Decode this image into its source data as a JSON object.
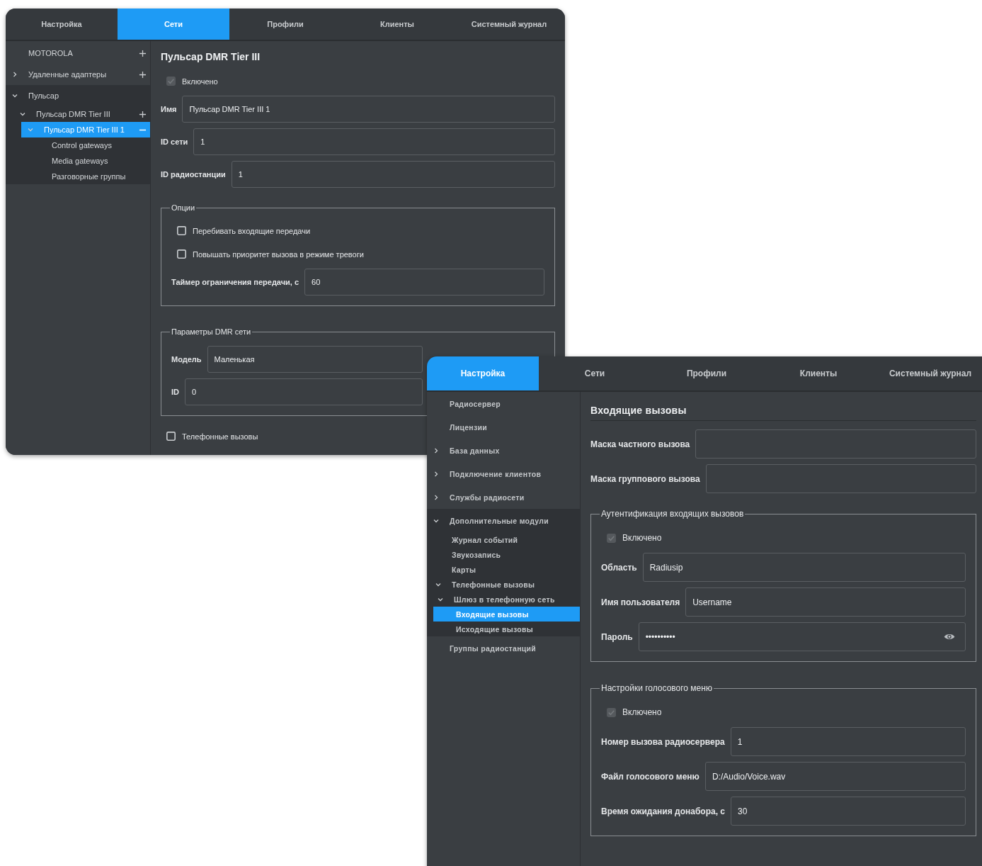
{
  "windows": [
    {
      "tabs": [
        {
          "label": "Настройка",
          "selected": false
        },
        {
          "label": "Сети",
          "selected": true
        },
        {
          "label": "Профили",
          "selected": false
        },
        {
          "label": "Клиенты",
          "selected": false
        },
        {
          "label": "Системный журнал",
          "selected": false
        }
      ],
      "sidebar": {
        "items": [
          {
            "kind": "add",
            "label": "MOTOROLA",
            "selected": false
          },
          {
            "kind": "add",
            "label": "Удаленные адаптеры",
            "selected": false,
            "expanded": false
          },
          {
            "label": "Пульсар",
            "selected": false,
            "expanded": true,
            "children": [
              {
                "kind": "add",
                "label": "Пульсар DMR Tier III",
                "selected": false,
                "expanded": true,
                "children": [
                  {
                    "kind": "remove",
                    "label": "Пульсар DMR Tier III 1",
                    "selected": true,
                    "expanded": true,
                    "children": [
                      {
                        "label": "Control gateways",
                        "selected": false
                      },
                      {
                        "label": "Media gateways",
                        "selected": false
                      },
                      {
                        "label": "Разговорные группы",
                        "selected": false
                      }
                    ]
                  }
                ]
              }
            ]
          }
        ]
      },
      "content": {
        "title": "Пульсар DMR Tier III",
        "items": [
          {
            "kind": "checkbox",
            "label": "Включено",
            "checked": true,
            "disabled": true
          },
          {
            "kind": "field",
            "label": "Имя",
            "value": "Пульсар DMR Tier III 1"
          },
          {
            "kind": "field",
            "label": "ID сети",
            "value": "1"
          },
          {
            "kind": "field",
            "label": "ID радиостанции",
            "value": "1"
          },
          {
            "kind": "group",
            "legend": "Опции",
            "items": [
              {
                "kind": "checkbox",
                "label": "Перебивать входящие передачи",
                "checked": false,
                "disabled": false
              },
              {
                "kind": "checkbox",
                "label": "Повышать приоритет вызова в режиме тревоги",
                "checked": false,
                "disabled": false
              },
              {
                "kind": "field",
                "label": "Таймер ограничения передачи, с",
                "value": "60"
              }
            ]
          },
          {
            "kind": "group",
            "legend": "Параметры DMR сети",
            "items": [
              {
                "kind": "field",
                "label": "Модель",
                "value": "Маленькая"
              },
              {
                "kind": "field",
                "label": "ID",
                "value": "0"
              }
            ]
          },
          {
            "kind": "checkbox",
            "label": "Телефонные вызовы",
            "checked": false,
            "disabled": false
          }
        ]
      }
    },
    {
      "tabs": [
        {
          "label": "Настройка",
          "selected": true
        },
        {
          "label": "Сети",
          "selected": false
        },
        {
          "label": "Профили",
          "selected": false
        },
        {
          "label": "Клиенты",
          "selected": false
        },
        {
          "label": "Системный журнал",
          "selected": false
        }
      ],
      "sidebar": {
        "items": [
          {
            "label": "Радиосервер",
            "selected": false
          },
          {
            "label": "Лицензии",
            "selected": false
          },
          {
            "label": "База данных",
            "selected": false,
            "expanded": false
          },
          {
            "label": "Подключение клиентов",
            "selected": false,
            "expanded": false
          },
          {
            "label": "Службы радиосети",
            "selected": false,
            "expanded": false
          },
          {
            "label": "Дополнительные модули",
            "selected": false,
            "expanded": true,
            "children": [
              {
                "label": "Журнал событий",
                "selected": false
              },
              {
                "label": "Звукозапись",
                "selected": false
              },
              {
                "label": "Карты",
                "selected": false
              },
              {
                "label": "Телефонные вызовы",
                "selected": false,
                "expanded": true,
                "children": [
                  {
                    "label": "Шлюз в телефонную сеть",
                    "selected": false,
                    "expanded": true,
                    "children": [
                      {
                        "label": "Входящие вызовы",
                        "selected": true
                      },
                      {
                        "label": "Исходящие вызовы",
                        "selected": false
                      }
                    ]
                  }
                ]
              }
            ]
          },
          {
            "label": "Группы радиостанций",
            "selected": false
          }
        ]
      },
      "content": {
        "title": "Входящие вызовы",
        "items": [
          {
            "kind": "field",
            "label": "Маска частного вызова"
          },
          {
            "kind": "field",
            "label": "Маска группового вызова"
          },
          {
            "kind": "group",
            "legend": "Аутентификация входящих вызовов",
            "items": [
              {
                "kind": "checkbox",
                "label": "Включено",
                "checked": true,
                "disabled": true
              },
              {
                "kind": "field",
                "label": "Область",
                "value": "Radiusip"
              },
              {
                "kind": "field",
                "label": "Имя пользователя",
                "value": "Username"
              },
              {
                "kind": "password",
                "label": "Пароль",
                "value": "••••••••••"
              }
            ]
          },
          {
            "kind": "group",
            "legend": "Настройки голосового меню",
            "items": [
              {
                "kind": "checkbox",
                "label": "Включено",
                "checked": true,
                "disabled": true
              },
              {
                "kind": "field",
                "label": "Номер вызова радиосервера",
                "value": "1"
              },
              {
                "kind": "field",
                "label": "Файл голосового меню",
                "value": "D:/Audio/Voice.wav"
              },
              {
                "kind": "field",
                "label": "Время ожидания донабора, с",
                "value": "30"
              }
            ]
          }
        ]
      }
    }
  ]
}
